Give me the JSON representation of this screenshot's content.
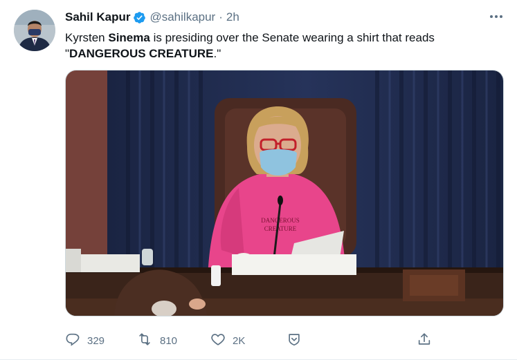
{
  "tweet": {
    "author_name": "Sahil Kapur",
    "author_handle": "@sahilkapur",
    "separator": "·",
    "time": "2h",
    "text_part1": "Kyrsten ",
    "text_bold1": "Sinema",
    "text_part2": " is presiding over the Senate wearing a shirt that reads \"",
    "text_bold2": "DANGEROUS CREATURE",
    "text_part3": ".\"",
    "media_shirt_line1": "DANGEROUS",
    "media_shirt_line2": "CREATURE"
  },
  "actions": {
    "reply_count": "329",
    "retweet_count": "810",
    "like_count": "2K"
  },
  "colors": {
    "verified_badge": "#1d9bf0",
    "icon_gray": "#5b7083",
    "shirt_pink": "#e8458b",
    "curtain_blue": "#1f2c4e"
  },
  "icons": [
    "verified-badge-icon",
    "more-options-icon",
    "reply-icon",
    "retweet-icon",
    "like-icon",
    "bookmark-icon",
    "share-icon"
  ]
}
